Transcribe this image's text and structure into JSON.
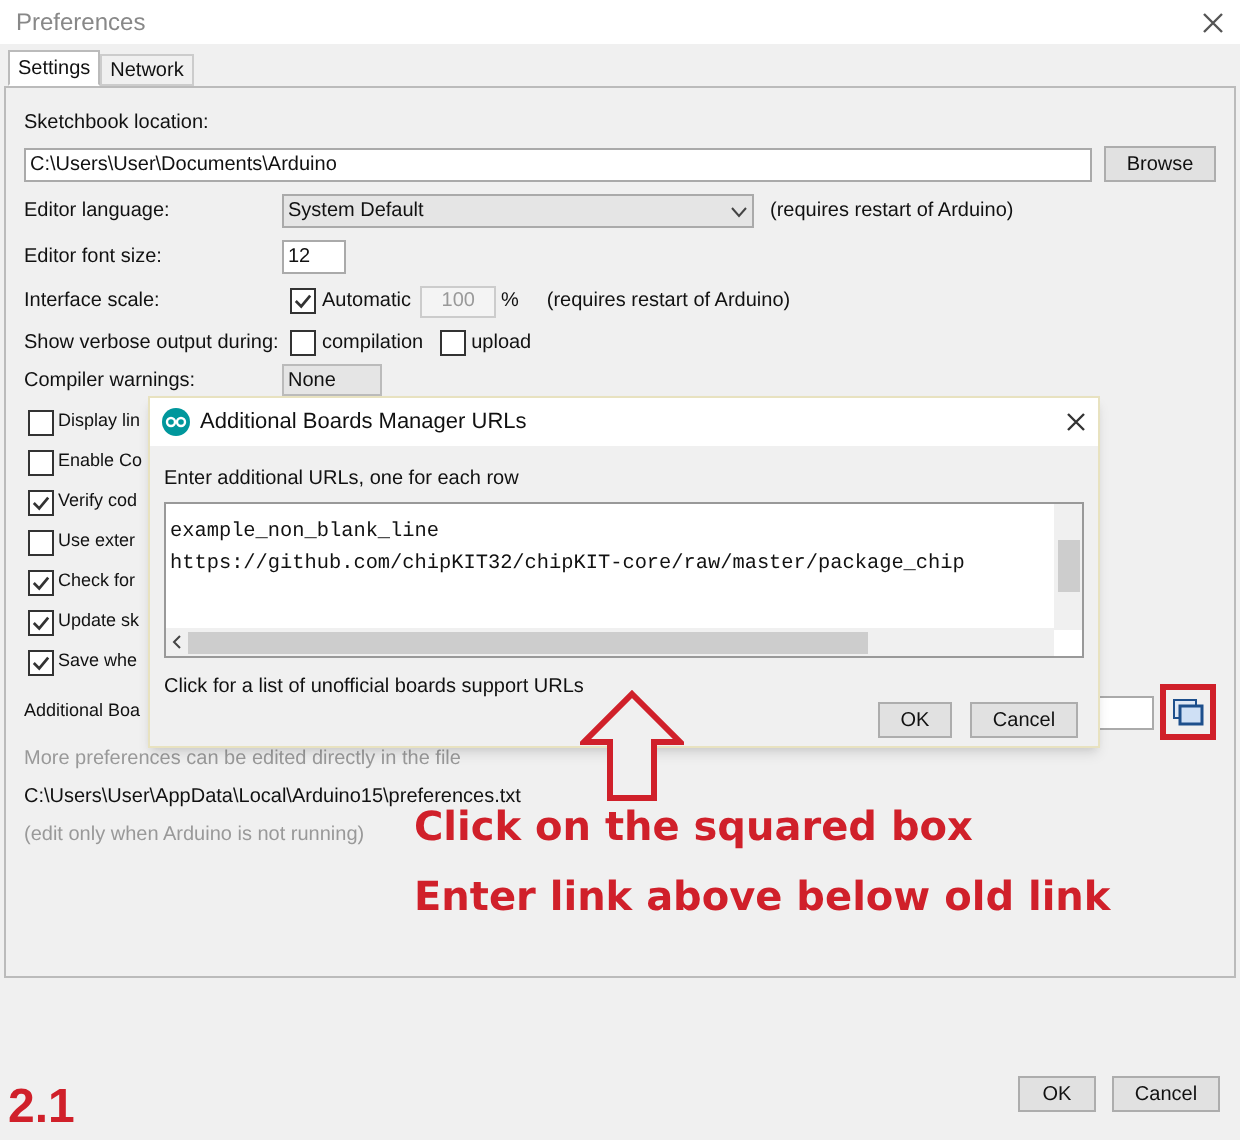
{
  "window": {
    "title": "Preferences"
  },
  "tabs": [
    {
      "label": "Settings",
      "selected": true
    },
    {
      "label": "Network",
      "selected": false
    }
  ],
  "sketchbook": {
    "label": "Sketchbook location:",
    "value": "C:\\Users\\User\\Documents\\Arduino",
    "button": "Browse"
  },
  "editor_language": {
    "label": "Editor language:",
    "value": "System Default",
    "note": "(requires restart of Arduino)"
  },
  "font_size": {
    "label": "Editor font size:",
    "value": "12"
  },
  "interface_scale": {
    "label": "Interface scale:",
    "checkbox": "Automatic",
    "checked": true,
    "value": "100",
    "unit": "%",
    "note": "(requires restart of Arduino)"
  },
  "verbose": {
    "label": "Show verbose output during:",
    "options": [
      {
        "label": "compilation",
        "checked": false
      },
      {
        "label": "upload",
        "checked": false
      }
    ]
  },
  "compiler_warnings": {
    "label": "Compiler warnings:",
    "value": "None"
  },
  "options": [
    {
      "label": "Display lin",
      "checked": false
    },
    {
      "label": "Enable Co",
      "checked": false
    },
    {
      "label": "Verify cod",
      "checked": true
    },
    {
      "label": "Use exter",
      "checked": false
    },
    {
      "label": "Check for",
      "checked": true
    },
    {
      "label": "Update sk",
      "checked": true
    },
    {
      "label": "Save whe",
      "checked": true
    }
  ],
  "additional_urls": {
    "label": "Additional Boa"
  },
  "more_note": "More preferences can be edited directly in the file",
  "prefs_path": "C:\\Users\\User\\AppData\\Local\\Arduino15\\preferences.txt",
  "edit_note": "(edit only when Arduino is not running)",
  "buttons": [
    "OK",
    "Cancel"
  ],
  "dialog": {
    "title": "Additional Boards Manager URLs",
    "prompt": "Enter additional URLs, one for each row",
    "lines": [
      "example_non_blank_line",
      "https://github.com/chipKIT32/chipKIT-core/raw/master/package_chip"
    ],
    "link": "Click for a list of unofficial boards support URLs",
    "buttons": [
      "OK",
      "Cancel"
    ]
  },
  "annotation": {
    "lines": [
      "Click on the squared box",
      "Enter link above below old link"
    ],
    "step": "2.1"
  }
}
